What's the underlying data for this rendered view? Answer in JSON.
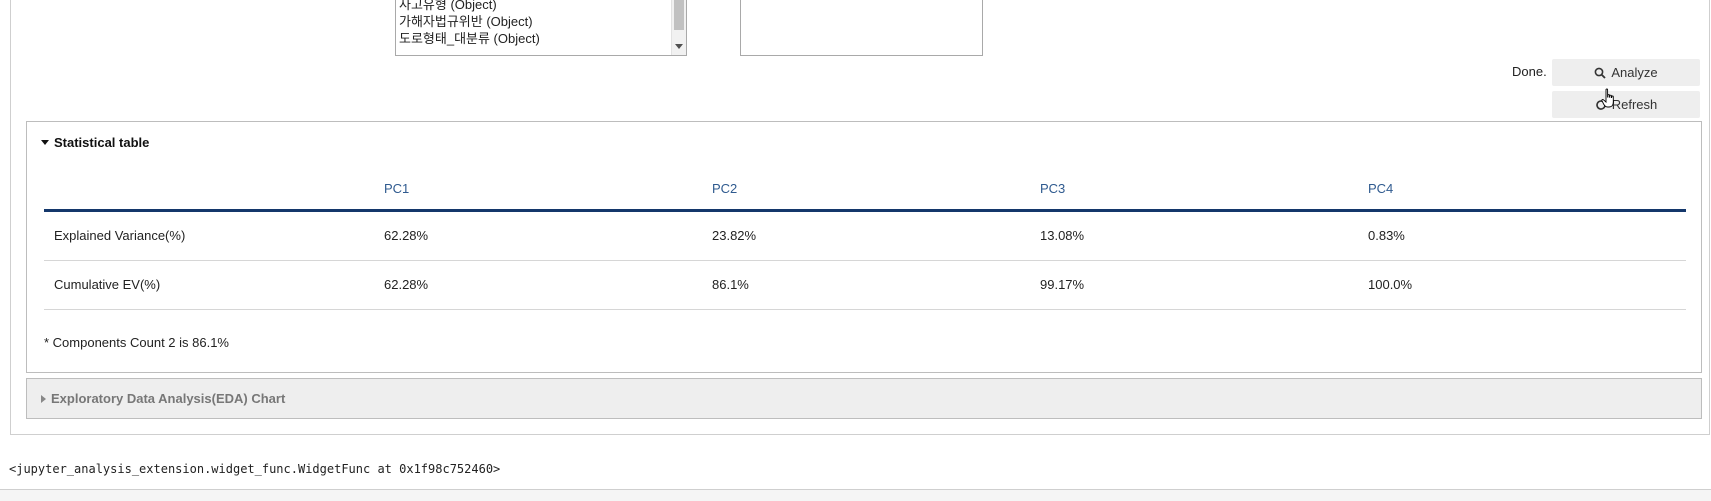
{
  "variable_list": {
    "options": [
      "사고유형 (Object)",
      "가해자법규위반 (Object)",
      "도로형태_대분류 (Object)"
    ]
  },
  "status": {
    "done_label": "Done."
  },
  "buttons": {
    "analyze_label": "Analyze",
    "refresh_label": "Refresh"
  },
  "stat_panel": {
    "title": "Statistical table",
    "columns": [
      "",
      "PC1",
      "PC2",
      "PC3",
      "PC4"
    ],
    "rows": [
      {
        "label": "Explained Variance(%)",
        "values": [
          "62.28%",
          "23.82%",
          "13.08%",
          "0.83%"
        ]
      },
      {
        "label": "Cumulative EV(%)",
        "values": [
          "62.28%",
          "86.1%",
          "99.17%",
          "100.0%"
        ]
      }
    ],
    "note": "* Components Count 2 is 86.1%"
  },
  "eda_panel": {
    "title": "Exploratory Data Analysis(EDA) Chart"
  },
  "output": {
    "repr": "<jupyter_analysis_extension.widget_func.WidgetFunc at 0x1f98c752460>"
  },
  "colors": {
    "header_rule": "#14376b",
    "header_text": "#2f5a8f",
    "button_bg": "#eeeeee"
  },
  "icons": {
    "analyze": "search-icon",
    "refresh": "refresh-icon"
  }
}
